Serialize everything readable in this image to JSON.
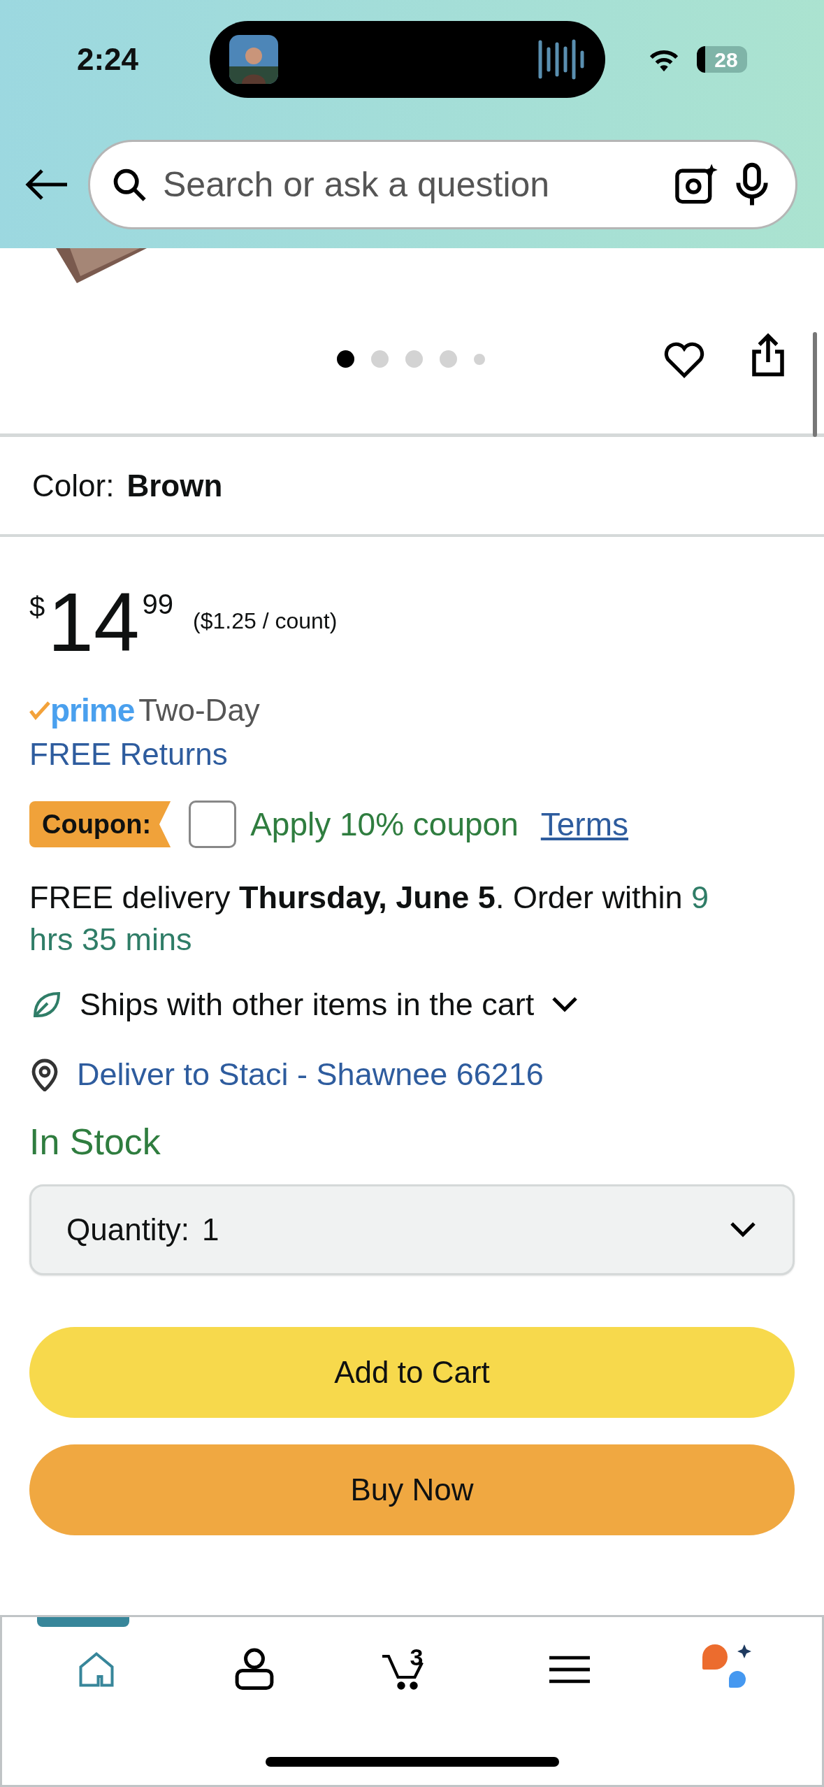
{
  "status_bar": {
    "time": "2:24",
    "battery": "28"
  },
  "search": {
    "placeholder": "Search or ask a question"
  },
  "carousel": {
    "dots": [
      {
        "selected": true
      },
      {
        "selected": false
      },
      {
        "selected": false
      },
      {
        "selected": false
      },
      {
        "selected": false
      }
    ]
  },
  "color": {
    "label": "Color:",
    "value": "Brown"
  },
  "price": {
    "currency": "$",
    "whole": "14",
    "fraction": "99",
    "unit_price": "($1.25 / count)"
  },
  "prime": {
    "logo": "prime",
    "speed": "Two-Day"
  },
  "returns": "FREE Returns",
  "coupon": {
    "badge": "Coupon:",
    "checked": false,
    "label": "Apply 10% coupon",
    "terms": "Terms"
  },
  "delivery": {
    "text": "FREE delivery **Thursday, June 5**. Order within ",
    "countdown": "9 hrs 35 mins"
  },
  "shipping_option": "Ships with other items in the cart",
  "deliver_to": "Deliver to Staci - Shawnee 66216",
  "stock": "In Stock",
  "quantity": {
    "label": "Quantity:",
    "value": "1"
  },
  "buttons": [
    {
      "label": "Add to Cart",
      "kind": "cart"
    },
    {
      "label": "Buy Now",
      "kind": "buy"
    }
  ],
  "tab_bar": {
    "items": [
      {
        "kind": "home",
        "selected": true
      },
      {
        "kind": "account",
        "selected": false
      },
      {
        "kind": "cart",
        "selected": false,
        "count": "3"
      },
      {
        "kind": "menu",
        "selected": false
      },
      {
        "kind": "assistant",
        "selected": false
      }
    ]
  }
}
